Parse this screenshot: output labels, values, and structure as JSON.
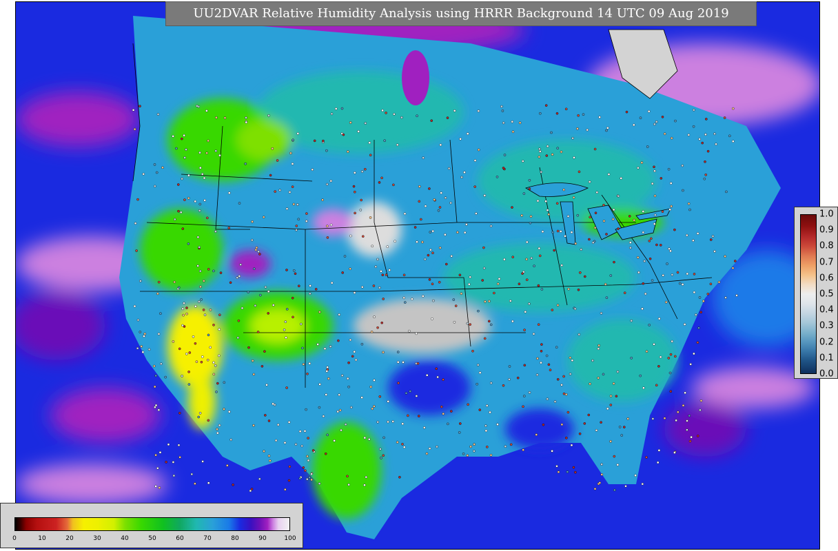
{
  "title": "UU2DVAR Relative Humidity Analysis using HRRR Background 14 UTC 09 Aug 2019",
  "rh_colorbar": {
    "ticks": [
      "0",
      "10",
      "20",
      "30",
      "40",
      "50",
      "60",
      "70",
      "80",
      "90",
      "100"
    ],
    "range": [
      0,
      100
    ]
  },
  "ratio_colorbar": {
    "ticks": [
      "1.0",
      "0.9",
      "0.8",
      "0.7",
      "0.6",
      "0.5",
      "0.4",
      "0.3",
      "0.2",
      "0.1",
      "0.0"
    ],
    "range": [
      0.0,
      1.0
    ]
  },
  "colors": {
    "background_land": "#c9c9c9",
    "ocean": "#1a2ae0",
    "humid": "#1a7ae8",
    "moist": "#20b8b0",
    "dry": "#10c020",
    "very_dry": "#f6f000",
    "saturated": "#a020c0",
    "title_bg": "#7a7a7a",
    "title_fg": "#ffffff"
  }
}
